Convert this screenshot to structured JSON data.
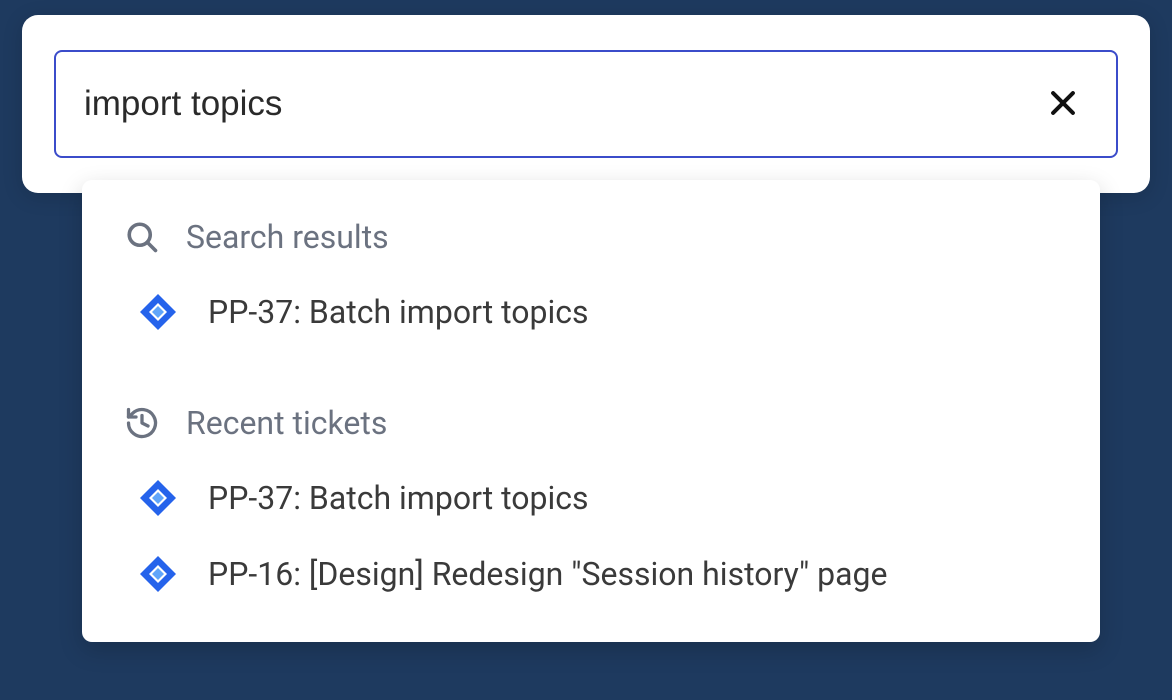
{
  "search": {
    "value": "import topics",
    "placeholder": ""
  },
  "sections": {
    "results": {
      "label": "Search results",
      "items": [
        {
          "label": "PP-37: Batch import topics"
        }
      ]
    },
    "recent": {
      "label": "Recent tickets",
      "items": [
        {
          "label": "PP-37: Batch import topics"
        },
        {
          "label": "PP-16: [Design] Redesign \"Session history\" page"
        }
      ]
    }
  }
}
